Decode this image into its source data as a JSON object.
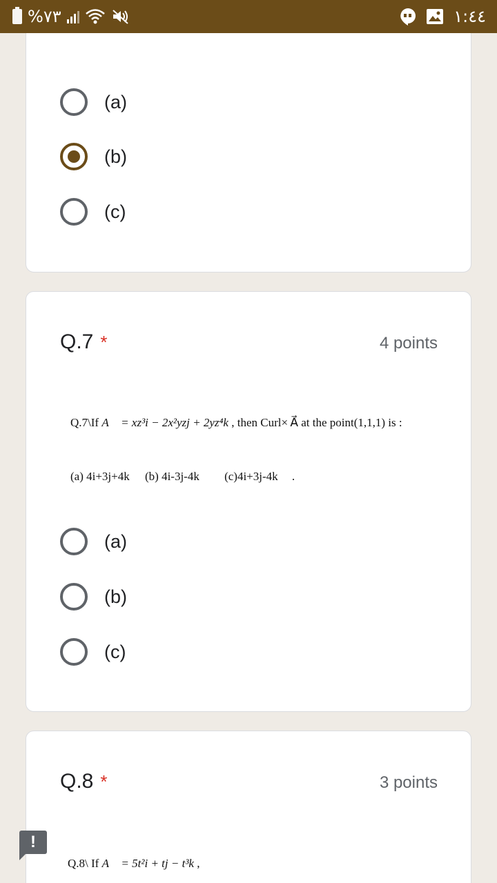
{
  "statusbar": {
    "battery_text": "%٧٣",
    "time": "١:٤٤",
    "icons": [
      "battery-icon",
      "signal-icon",
      "wifi-icon",
      "mute-icon",
      "hangouts-icon",
      "gallery-icon"
    ]
  },
  "colors": {
    "brand": "#6b4c18",
    "background": "#efebe5",
    "required": "#d93025"
  },
  "card_prev": {
    "options": [
      {
        "label": "(a)",
        "checked": false
      },
      {
        "label": "(b)",
        "checked": true
      },
      {
        "label": "(c)",
        "checked": false
      }
    ]
  },
  "q7": {
    "title": "Q.7",
    "required_mark": "*",
    "points": "4 points",
    "image_line1_prefix": "Q.7\\If ",
    "image_line1_formula": "A⃗ = xz³i − 2x²yzj + 2yz⁴k",
    "image_line1_suffix": " , then Curl× A⃗  at the point(1,1,1)  is :",
    "image_line2_a": "(a) 4i+3j+4k",
    "image_line2_b": "(b) 4i-3j-4k",
    "image_line2_c": "(c)4i+3j-4k",
    "image_line2_end": ".",
    "options": [
      {
        "label": "(a)",
        "checked": false
      },
      {
        "label": "(b)",
        "checked": false
      },
      {
        "label": "(c)",
        "checked": false
      }
    ]
  },
  "q8": {
    "title": "Q.8",
    "required_mark": "*",
    "points": "3 points",
    "image_line1_prefix": "Q.8\\ If ",
    "image_line1_formula": "A⃗ = 5t²i + tj − t³k",
    "image_line1_suffix": "  ,"
  },
  "feedback_label": "!"
}
